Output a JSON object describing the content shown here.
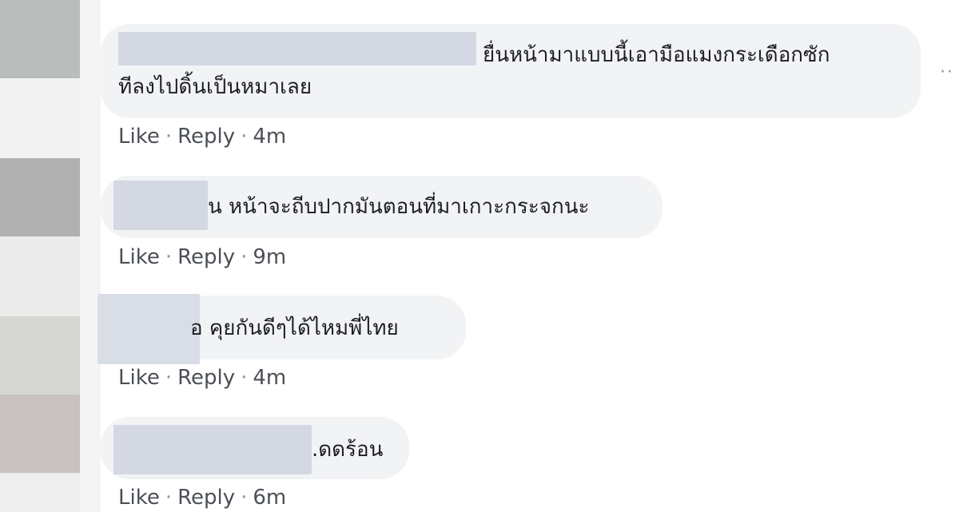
{
  "comments": [
    {
      "text_line1": "ยื่นหน้ามาแบบนี้เอามือแมงกระเดือกซัก",
      "text_line2": "ทีลงไปดิ้นเป็นหมาเลย",
      "like": "Like",
      "reply": "Reply",
      "time": "4m"
    },
    {
      "text_line1": "น หน้าจะถีบปากมันตอนที่มาเกาะกระจกนะ",
      "like": "Like",
      "reply": "Reply",
      "time": "9m"
    },
    {
      "text_line1": "อ คุยกันดีๆได้ไหมพี่ไทย",
      "like": "Like",
      "reply": "Reply",
      "time": "4m"
    },
    {
      "text_line1": ".ดดร้อน",
      "like": "Like",
      "reply": "Reply",
      "time": "6m"
    }
  ],
  "separator": "·",
  "more_options": "··",
  "colors": {
    "bubble": "#f2f3f5",
    "text": "#1c1e21",
    "meta": "#4b4f56",
    "redaction": "#d4d8e3"
  },
  "icons": [
    "more-options-icon"
  ]
}
